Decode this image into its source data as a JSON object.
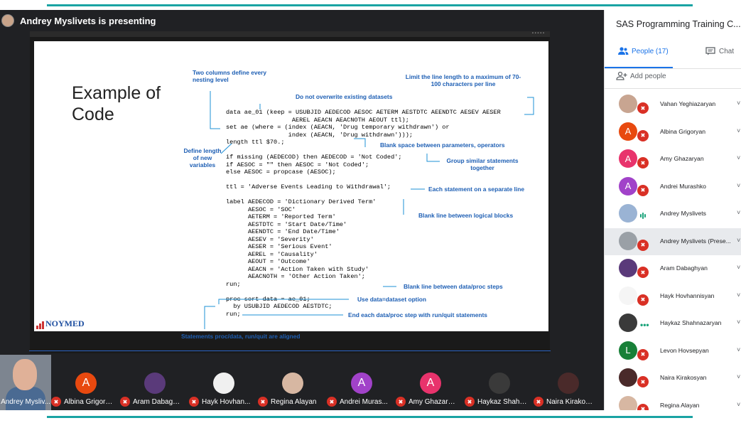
{
  "presenter": {
    "label": "Andrey Myslivets is presenting"
  },
  "slide": {
    "title": "Example of\nCode",
    "code_lines": [
      "data ae_01 (keep = USUBJID AEDECOD AESOC AETERM AESTDTC AEENDTC AESEV AESER",
      "                  AEREL AEACN AEACNOTH AEOUT ttl);",
      "set ae (where = (index (AEACN, 'Drug temporary withdrawn') or",
      "                 index (AEACN, 'Drug withdrawn')));",
      "length ttl $70.;",
      "",
      "if missing (AEDECOD) then AEDECOD = 'Not Coded';",
      "if AESOC = \"\" then AESOC = 'Not Coded';",
      "else AESOC = propcase (AESOC);",
      "",
      "ttl = 'Adverse Events Leading to Withdrawal';",
      "",
      "label AEDECOD = 'Dictionary Derived Term'",
      "      AESOC = 'SOC'",
      "      AETERM = 'Reported Term'",
      "      AESTDTC = 'Start Date/Time'",
      "      AEENDTC = 'End Date/Time'",
      "      AESEV = 'Severity'",
      "      AESER = 'Serious Event'",
      "      AEREL = 'Causality'",
      "      AEOUT = 'Outcome'",
      "      AEACN = 'Action Taken with Study'",
      "      AEACNOTH = 'Other Action Taken';",
      "run;",
      "",
      "proc sort data = ae_01;",
      "  by USUBJID AEDECOD AESTDTC;",
      "run;"
    ],
    "annotations": {
      "two_columns": "Two columns define every nesting level",
      "no_overwrite": "Do not overwrite existing datasets",
      "limit_line": "Limit the line length to a maximum of 70-100 characters per line",
      "define_length": "Define length of new variables",
      "blank_space": "Blank space between parameters, operators",
      "group_similar": "Group similar statements together",
      "separate_line": "Each statement on a separate line",
      "blank_logical": "Blank line between logical blocks",
      "blank_steps": "Blank line between data/proc steps",
      "use_data": "Use data=dataset option",
      "end_step": "End each data/proc step with run/quit statements",
      "aligned": "Statements proc/data, run/quit are aligned"
    },
    "logo": "NOYMED"
  },
  "filmstrip": {
    "self_name": "Andrey Mysliv...",
    "tiles": [
      {
        "name": "Albina Grigory...",
        "initial": "A",
        "color": "#e8490f"
      },
      {
        "name": "Aram Dabagh...",
        "initial": "",
        "color": "#5a3a7a"
      },
      {
        "name": "Hayk Hovhan...",
        "initial": "",
        "color": "#f0f0f0"
      },
      {
        "name": "Regina Alayan",
        "initial": "",
        "color": "#d7b7a2"
      },
      {
        "name": "Andrei Muras...",
        "initial": "A",
        "color": "#a142c9"
      },
      {
        "name": "Amy Ghazaryan",
        "initial": "A",
        "color": "#e8336c"
      },
      {
        "name": "Haykaz Shahn...",
        "initial": "",
        "color": "#3a3a3a"
      },
      {
        "name": "Naira Kirakosy...",
        "initial": "",
        "color": "#4a2a2a"
      }
    ]
  },
  "side": {
    "title": "SAS Programming Training C...",
    "tab_people": "People (17)",
    "tab_chat": "Chat",
    "add_people": "Add people",
    "people": [
      {
        "name": "Vahan Yeghiazaryan",
        "initial": "",
        "color": "#c8a591",
        "muted": true
      },
      {
        "name": "Albina Grigoryan",
        "initial": "A",
        "color": "#e8490f",
        "muted": true
      },
      {
        "name": "Amy Ghazaryan",
        "initial": "A",
        "color": "#e8336c",
        "muted": true
      },
      {
        "name": "Andrei Murashko",
        "initial": "A",
        "color": "#a142c9",
        "muted": true
      },
      {
        "name": "Andrey Myslivets",
        "initial": "",
        "color": "#9ab3d4",
        "muted": false
      },
      {
        "name": "Andrey Myslivets (Prese...",
        "initial": "",
        "color": "#9aa0a6",
        "muted": true
      },
      {
        "name": "Aram Dabaghyan",
        "initial": "",
        "color": "#5a3a7a",
        "muted": true
      },
      {
        "name": "Hayk Hovhannisyan",
        "initial": "",
        "color": "#f5f5f5",
        "muted": true
      },
      {
        "name": "Haykaz Shahnazaryan",
        "initial": "",
        "color": "#3a3a3a",
        "muted": false
      },
      {
        "name": "Levon Hovsepyan",
        "initial": "L",
        "color": "#188038",
        "muted": true
      },
      {
        "name": "Naira Kirakosyan",
        "initial": "",
        "color": "#4a2a2a",
        "muted": true
      },
      {
        "name": "Regina Alayan",
        "initial": "",
        "color": "#d7b7a2",
        "muted": true
      }
    ]
  }
}
